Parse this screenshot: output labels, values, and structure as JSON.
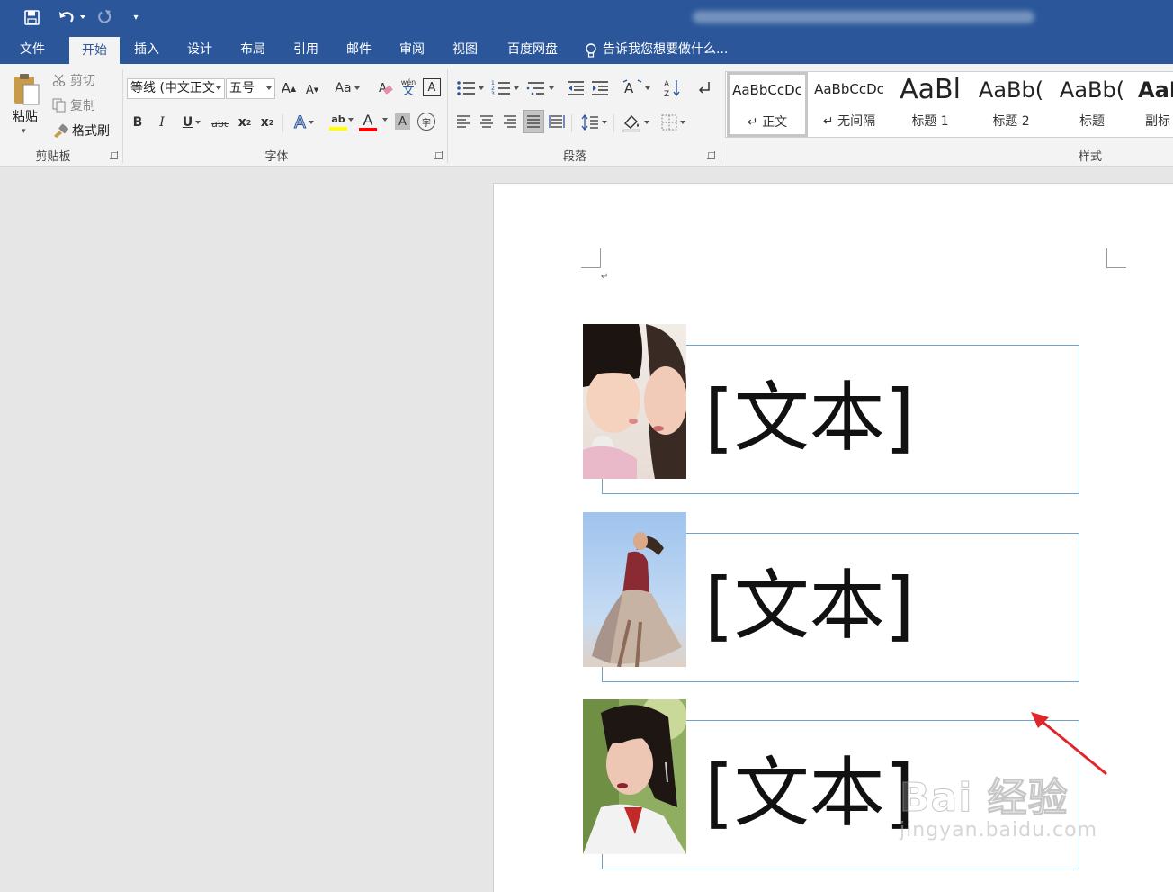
{
  "tabs": [
    "文件",
    "开始",
    "插入",
    "设计",
    "布局",
    "引用",
    "邮件",
    "审阅",
    "视图",
    "百度网盘"
  ],
  "active_tab": "开始",
  "tell_me": "告诉我您想要做什么...",
  "clipboard": {
    "paste": "粘贴",
    "cut": "剪切",
    "copy": "复制",
    "format_painter": "格式刷",
    "label": "剪贴板"
  },
  "font": {
    "family": "等线 (中文正文",
    "size": "五号",
    "label": "字体",
    "bold": "B",
    "italic": "I",
    "underline": "U",
    "strikethrough": "abc",
    "grow": "A",
    "shrink": "A",
    "case": "Aa",
    "pinyin": "wén",
    "pinyin_char": "文",
    "border_char": "A",
    "effects": "A",
    "highlight": "ab",
    "color": "A",
    "shading": "A",
    "enclose": "字",
    "sub": "x",
    "sub_mark": "2",
    "sup": "x",
    "sup_mark": "2"
  },
  "paragraph": {
    "label": "段落"
  },
  "styles": {
    "label": "样式",
    "items": [
      {
        "sample": "AaBbCcDc",
        "name": "↵ 正文"
      },
      {
        "sample": "AaBbCcDc",
        "name": "↵ 无间隔"
      },
      {
        "sample": "AaBl",
        "name": "标题 1"
      },
      {
        "sample": "AaBb(",
        "name": "标题 2"
      },
      {
        "sample": "AaBb(",
        "name": "标题"
      },
      {
        "sample": "AaE",
        "name": "副标"
      }
    ]
  },
  "document": {
    "paragraph_mark": "↵",
    "textboxes": [
      "[文本]",
      "[文本]",
      "[文本]"
    ]
  },
  "watermark": {
    "main": "Bai 经验",
    "sub": "jingyan.baidu.com"
  },
  "colors": {
    "brand": "#2b579a",
    "highlight": "#ffff00",
    "font_color": "#ff0000",
    "textbox_border": "#6fa1c9",
    "arrow": "#e0262b"
  }
}
